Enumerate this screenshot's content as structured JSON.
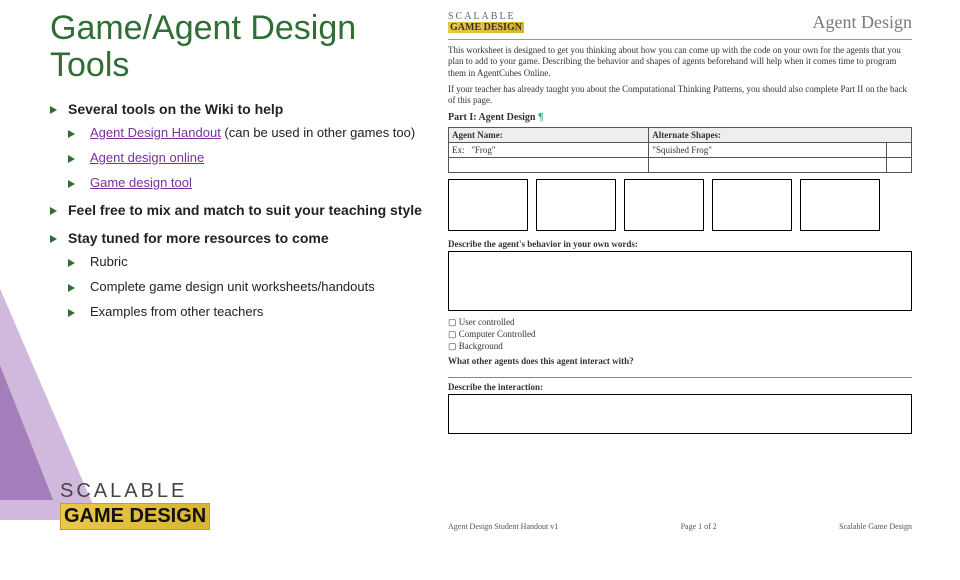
{
  "title": "Game/Agent Design Tools",
  "bullets": {
    "b1": "Several tools on the Wiki to help",
    "b1a_link": "Agent Design Handout",
    "b1a_rest": " (can be used in other games too)",
    "b1b": "Agent design online",
    "b1c": "Game design tool",
    "b2": "Feel free to mix and match to suit your teaching style",
    "b3": "Stay tuned for more resources to come",
    "b3a": "Rubric",
    "b3b": "Complete game design unit worksheets/handouts",
    "b3c": "Examples from other teachers"
  },
  "logo": {
    "row1": "SCALABLE",
    "row2": "GAME DESIGN"
  },
  "doc": {
    "hdr_agd": "Agent Design",
    "intro": "This worksheet is designed to get you thinking about how you can come up with the code on your own for the agents that you plan to add to your game. Describing the behavior and shapes of agents beforehand will help when it comes time to program them in AgentCubes Online.",
    "teacher": "If your teacher has already taught you about the Computational Thinking Patterns, you should also complete Part II on the back of this page.",
    "part1": "Part I: Agent Design",
    "th1": "Agent Name:",
    "th2": "Alternate Shapes:",
    "ex": "Ex:",
    "frog": "\"Frog\"",
    "sq": "\"Squished Frog\"",
    "describe": "Describe the agent's behavior in your own words:",
    "opt1": "User controlled",
    "opt2": "Computer Controlled",
    "opt3": "Background",
    "inter": "What other agents does this agent interact with?",
    "desint": "Describe the interaction:",
    "f1": "Agent Design Student Handout v1",
    "f2": "Page 1 of 2",
    "f3": "Scalable Game Design"
  }
}
